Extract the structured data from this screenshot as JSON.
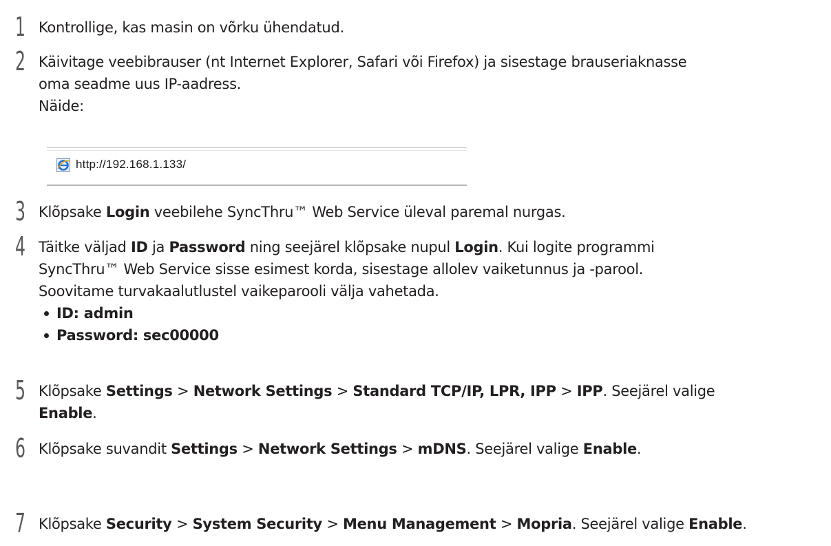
{
  "steps": [
    {
      "number": "1",
      "lines": [
        "Kontrollige, kas masin on võrku ühendatud."
      ]
    },
    {
      "number": "2",
      "lines": [
        "Käivitage veebibrauser (nt Internet Explorer, Safari või Firefox) ja sisestage brauseriaknasse",
        "oma seadme uus IP-aadress.",
        "Näide:"
      ]
    },
    {
      "number": "3",
      "parts": [
        "Klõpsake ",
        "Login",
        " veebilehe SyncThru™ Web Service üleval paremal nurgas."
      ]
    },
    {
      "number": "4",
      "line1": [
        "Täitke väljad ",
        "ID",
        " ja ",
        "Password",
        " ning seejärel klõpsake nupul ",
        "Login",
        ". Kui logite programmi"
      ],
      "line2": "SyncThru™ Web Service sisse esimest korda, sisestage allolev vaiketunnus ja -parool.",
      "line3": "Soovitame turvakaalutlustel vaikeparooli välja vahetada.",
      "bullets": [
        "ID: admin",
        "Password: sec00000"
      ]
    },
    {
      "number": "5",
      "line1": [
        "Klõpsake ",
        "Settings",
        " > ",
        "Network Settings",
        " > ",
        "Standard TCP/IP, LPR, IPP",
        " > ",
        "IPP",
        ". Seejärel valige"
      ],
      "line2": [
        "Enable",
        "."
      ]
    },
    {
      "number": "6",
      "line1": [
        "Klõpsake suvandit ",
        "Settings",
        " > ",
        "Network Settings",
        " > ",
        "mDNS",
        ". Seejärel valige ",
        "Enable",
        "."
      ]
    },
    {
      "number": "7",
      "line1": [
        "Klõpsake ",
        "Security",
        " > ",
        "System Security",
        " > ",
        "Menu Management",
        " > ",
        "Mopria",
        ". Seejärel valige ",
        "Enable",
        "."
      ]
    }
  ],
  "address_bar": {
    "url": "http://192.168.1.133/",
    "icon": "internet-explorer-icon"
  }
}
